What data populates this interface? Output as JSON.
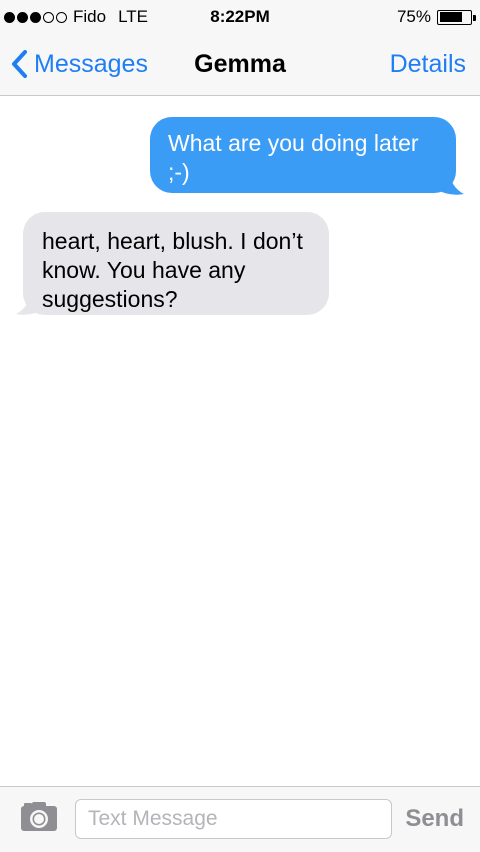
{
  "status_bar": {
    "signal_total": 5,
    "signal_filled": 3,
    "carrier": "Fido",
    "network": "LTE",
    "time": "8:22PM",
    "battery_text": "75%",
    "battery_level": 0.75
  },
  "nav": {
    "back_label": "Messages",
    "back_icon": "chevron-left-icon",
    "title": "Gemma",
    "details_label": "Details"
  },
  "messages": [
    {
      "direction": "sent",
      "text": "What are you doing later ;-)"
    },
    {
      "direction": "received",
      "text": "heart, heart, blush. I don’t know. You have any suggestions?"
    }
  ],
  "input_bar": {
    "camera_icon": "camera-icon",
    "placeholder": "Text Message",
    "value": "",
    "send_label": "Send"
  },
  "colors": {
    "accent": "#1f7ef3",
    "sent_bubble": "#3b9cf5",
    "received_bubble": "#e5e5ea",
    "bar_background": "#f7f7f7",
    "send_disabled": "#8e8e93"
  }
}
